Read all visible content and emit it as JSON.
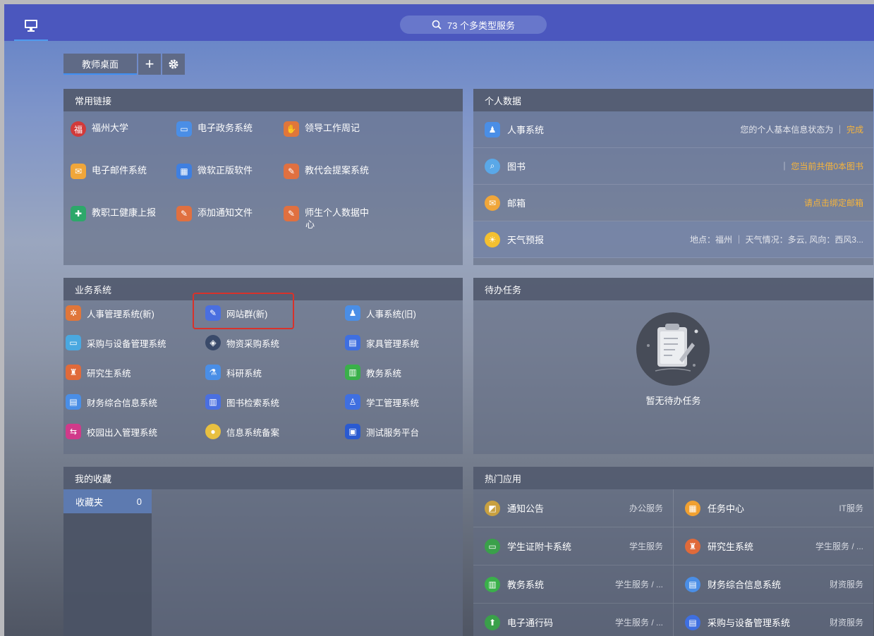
{
  "search": {
    "label": "73 个多类型服务"
  },
  "tabs": {
    "active_label": "教师桌面",
    "add_symbol": "+",
    "settings_symbol": "⚙"
  },
  "common_links": {
    "title": "常用链接",
    "items": [
      {
        "label": "福州大学",
        "icon": "university-logo-icon",
        "color": "#d23a3a"
      },
      {
        "label": "电子政务系统",
        "icon": "monitor-icon",
        "color": "#4a8ee6"
      },
      {
        "label": "领导工作周记",
        "icon": "handshake-icon",
        "color": "#e0763a"
      },
      {
        "label": "电子邮件系统",
        "icon": "mail-icon",
        "color": "#f0a63a"
      },
      {
        "label": "微软正版软件",
        "icon": "windows-icon",
        "color": "#3f7fe0"
      },
      {
        "label": "教代会提案系统",
        "icon": "document-icon",
        "color": "#e07040"
      },
      {
        "label": "教职工健康上报",
        "icon": "health-icon",
        "color": "#2da86a"
      },
      {
        "label": "添加通知文件",
        "icon": "document-icon",
        "color": "#e07040"
      },
      {
        "label": "师生个人数据中",
        "label2": "心",
        "icon": "document-icon",
        "color": "#e07040"
      }
    ]
  },
  "personal_data": {
    "title": "个人数据",
    "rows": [
      {
        "name": "人事系统",
        "icon": "person-icon",
        "color": "#4a8ee6",
        "right_text": "您的个人基本信息状态为 ｜ ",
        "right_highlight": "完成"
      },
      {
        "name": "图书",
        "icon": "book-search-icon",
        "color": "#5aa8e8",
        "right_text": "｜ ",
        "right_highlight": "您当前共借0本图书"
      },
      {
        "name": "邮箱",
        "icon": "mail-icon",
        "color": "#f0a63a",
        "right_text": "",
        "right_highlight": "请点击绑定邮箱"
      },
      {
        "name": "天气预报",
        "icon": "sun-icon",
        "color": "#f4c030",
        "right_text": "地点：福州 ｜ 天气情况：多云, 风向：西风3...",
        "right_highlight": ""
      }
    ]
  },
  "business_systems": {
    "title": "业务系统",
    "items": [
      {
        "label": "人事管理系统(新)",
        "icon": "gear-icon",
        "color": "#e0763a"
      },
      {
        "label": "网站群(新)",
        "icon": "edit-icon",
        "color": "#4a6fe0"
      },
      {
        "label": "人事系统(旧)",
        "icon": "person-icon",
        "color": "#4a8ee6"
      },
      {
        "label": "采购与设备管理系统",
        "icon": "screen-icon",
        "color": "#4aa8e0"
      },
      {
        "label": "物资采购系统",
        "icon": "layers-icon",
        "color": "#3a4a6a"
      },
      {
        "label": "家具管理系统",
        "icon": "chair-icon",
        "color": "#3f6fe0"
      },
      {
        "label": "研究生系统",
        "icon": "graduate-icon",
        "color": "#e06a3a"
      },
      {
        "label": "科研系统",
        "icon": "flask-icon",
        "color": "#4a8ee6"
      },
      {
        "label": "教务系统",
        "icon": "book-icon",
        "color": "#3ab04a"
      },
      {
        "label": "财务综合信息系统",
        "icon": "ledger-icon",
        "color": "#4a8ee6"
      },
      {
        "label": "图书检索系统",
        "icon": "library-icon",
        "color": "#4a6fe0"
      },
      {
        "label": "学工管理系统",
        "icon": "student-icon",
        "color": "#3f6fe0"
      },
      {
        "label": "校园出入管理系统",
        "icon": "gate-icon",
        "color": "#d03a8a"
      },
      {
        "label": "信息系统备案",
        "icon": "coin-icon",
        "color": "#e8c040"
      },
      {
        "label": "测试服务平台",
        "icon": "test-screen-icon",
        "color": "#2a5ad0"
      }
    ]
  },
  "todo": {
    "title": "待办任务",
    "empty_text": "暂无待办任务"
  },
  "favorites": {
    "title": "我的收藏",
    "folder_label": "收藏夹",
    "folder_count": "0"
  },
  "hot_apps": {
    "title": "热门应用",
    "items": [
      {
        "name": "通知公告",
        "cat": "办公服务",
        "icon": "notice-icon",
        "color": "#c8a040"
      },
      {
        "name": "任务中心",
        "cat": "IT服务",
        "icon": "calendar-icon",
        "color": "#f0a030"
      },
      {
        "name": "学生证附卡系统",
        "cat": "学生服务",
        "icon": "card-icon",
        "color": "#3aa04a"
      },
      {
        "name": "研究生系统",
        "cat": "学生服务 / ...",
        "icon": "graduate-icon",
        "color": "#e06a3a"
      },
      {
        "name": "教务系统",
        "cat": "学生服务 / ...",
        "icon": "book-icon",
        "color": "#3ab04a"
      },
      {
        "name": "财务综合信息系统",
        "cat": "财资服务",
        "icon": "ledger-icon",
        "color": "#4a8ee6"
      },
      {
        "name": "电子通行码",
        "cat": "学生服务 / ...",
        "icon": "pass-icon",
        "color": "#3aa04a"
      },
      {
        "name": "采购与设备管理系统",
        "cat": "财资服务",
        "icon": "chair-icon",
        "color": "#3f6fe0"
      }
    ]
  }
}
